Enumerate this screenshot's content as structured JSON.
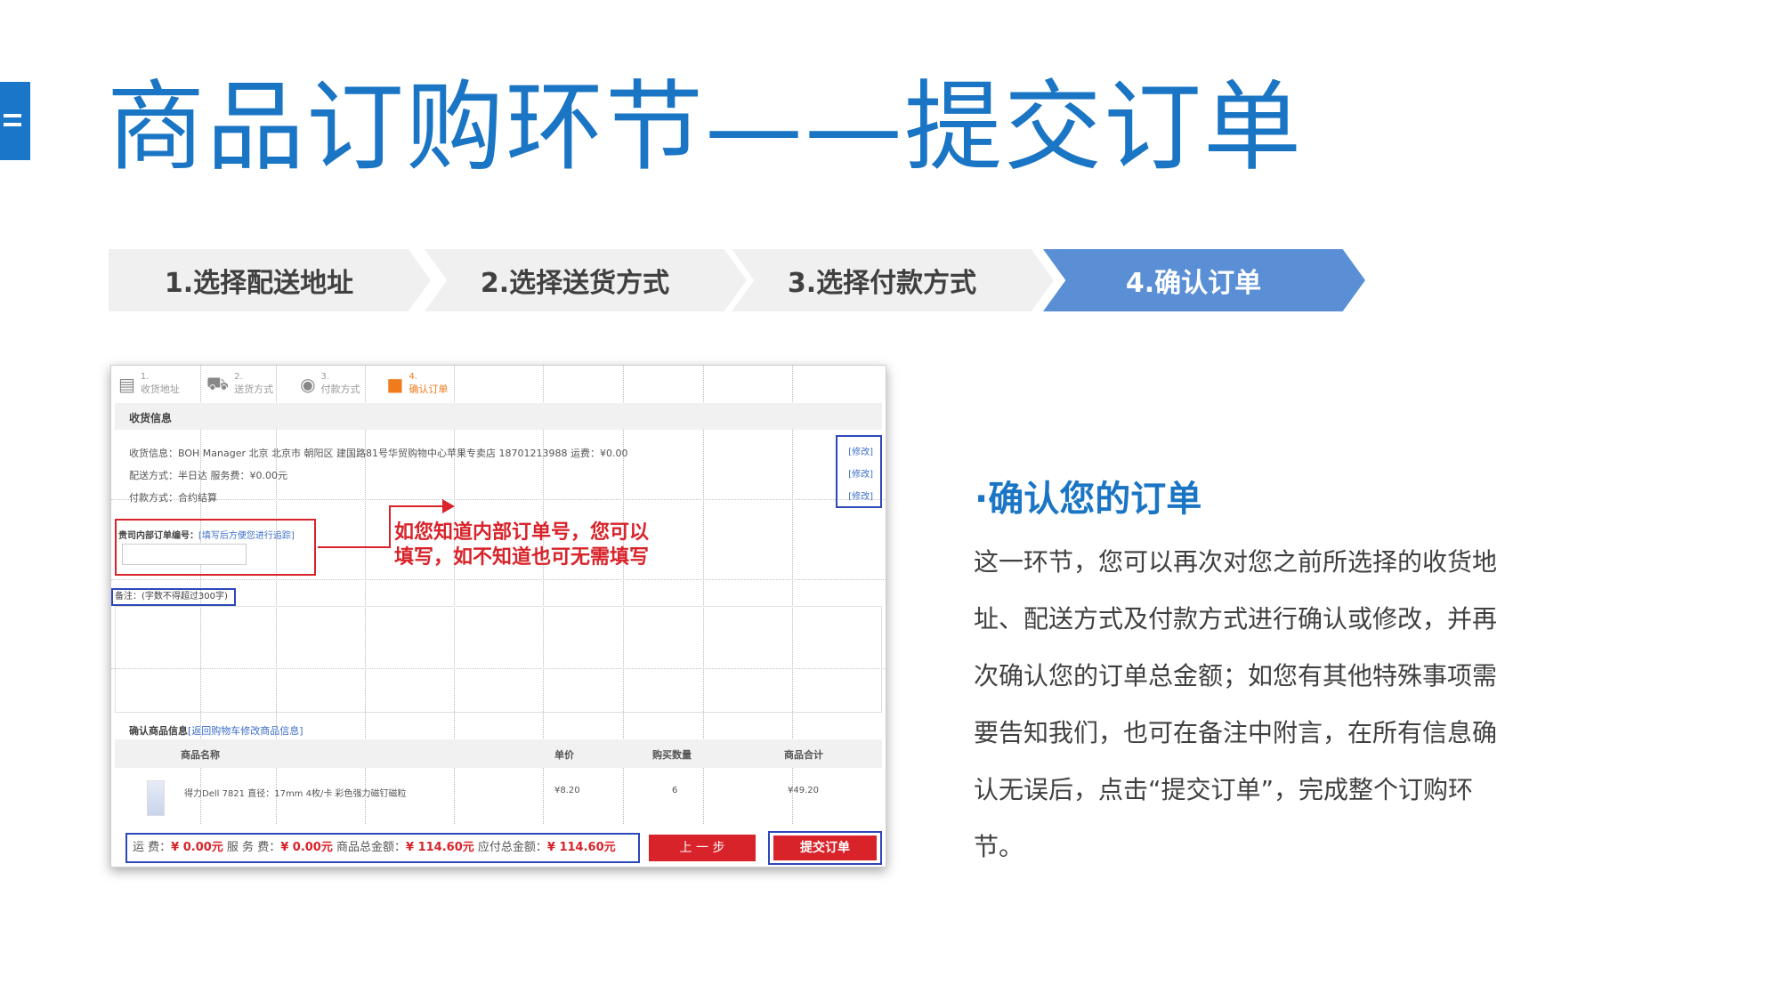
{
  "title": "商品订购环节——提交订单",
  "steps": [
    {
      "label": "1.选择配送地址"
    },
    {
      "label": "2.选择送货方式"
    },
    {
      "label": "3.选择付款方式"
    },
    {
      "label": "4.确认订单"
    }
  ],
  "screenshot": {
    "progress": [
      {
        "num": "1.",
        "label": "收货地址",
        "icon": "document-icon"
      },
      {
        "num": "2.",
        "label": "送货方式",
        "icon": "truck-icon"
      },
      {
        "num": "3.",
        "label": "付款方式",
        "icon": "medal-icon"
      },
      {
        "num": "4.",
        "label": "确认订单",
        "icon": "box-icon"
      }
    ],
    "receive_section": "收货信息",
    "receive_line": "收货信息：BOH Manager   北京 北京市 朝阳区 建国路81号华贸购物中心苹果专卖店 18701213988     运费：¥0.00",
    "delivery_line": "配送方式：半日达  服务费：¥0.00元",
    "payment_line": "付款方式：合约结算",
    "modify_labels": [
      "[修改]",
      "[修改]",
      "[修改]"
    ],
    "order_no_label": "贵司内部订单编号：",
    "order_no_link": "[填写后方便您进行追踪]",
    "callout": [
      "如您知道内部订单号，您可以",
      "填写，如不知道也可无需填写"
    ],
    "remark_label": "备注：(字数不得超过300字)",
    "confirm_label": "确认商品信息",
    "confirm_link": "[返回购物车修改商品信息]",
    "table_headers": [
      "商品名称",
      "单价",
      "购买数量",
      "商品合计"
    ],
    "row": {
      "name": "得力Dell 7821 直径：17mm 4枚/卡 彩色强力磁钉磁粒",
      "price": "¥8.20",
      "qty": "6",
      "total": "¥49.20"
    },
    "totals": {
      "freight_label": "运 费：",
      "freight_value": "¥ 0.00元",
      "service_label": " 服  务  费：",
      "service_value": "¥ 0.00元",
      "goods_label": " 商品总金额：",
      "goods_value": "¥ 114.60元",
      "payable_label": " 应付总金额：",
      "payable_value": "¥ 114.60元"
    },
    "prev_button": "上 一 步",
    "submit_button": "提交订单"
  },
  "right_panel": {
    "heading": "·确认您的订单",
    "body": "这一环节，您可以再次对您之前所选择的收货地址、配送方式及付款方式进行确认或修改，并再次确认您的订单总金额；如您有其他特殊事项需要告知我们，也可在备注中附言，在所有信息确认无误后，点击“提交订单”，完成整个订购环节。"
  }
}
